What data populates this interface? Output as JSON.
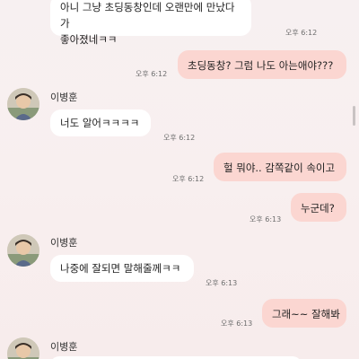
{
  "chat": {
    "messages": [
      {
        "text": "아니 그냥 초딩동창인데 오랜만에 만났다가\n좋아졌네ㅋㅋ",
        "time": "오후 6:12"
      },
      {
        "text": "초딩동창? 그럼 나도 아는애야???",
        "time": "오후 6:12"
      },
      {
        "sender": "이병훈",
        "text": "너도 알어ㅋㅋㅋㅋ",
        "time": "오후 6:12"
      },
      {
        "text": "헐 뭐야.. 감쪽같이 속이고",
        "time": "오후 6:12"
      },
      {
        "text": "누군데?",
        "time": "오후 6:13"
      },
      {
        "sender": "이병훈",
        "text": "나중에 잘되면 말해줄께ㅋㅋ",
        "time": "오후 6:13"
      },
      {
        "text": "그래~~ 잘해봐",
        "time": "오후 6:13"
      },
      {
        "sender": "이병훈"
      }
    ]
  },
  "colors": {
    "background": "#f7efef",
    "incoming_bubble": "#ffffff",
    "outgoing_bubble": "#fbd6d1"
  }
}
